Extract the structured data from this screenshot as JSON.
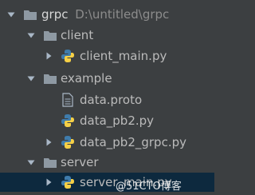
{
  "project_tree": {
    "root": {
      "name": "grpc",
      "path": "D:\\untitled\\grpc"
    },
    "items": [
      {
        "label": "client"
      },
      {
        "label": "client_main.py"
      },
      {
        "label": "example"
      },
      {
        "label": "data.proto"
      },
      {
        "label": "data_pb2.py"
      },
      {
        "label": "data_pb2_grpc.py"
      },
      {
        "label": "server"
      },
      {
        "label": "server_main.py"
      }
    ]
  },
  "watermark": "@51CTO博客",
  "colors": {
    "background": "#3c3f41",
    "selected_row": "#0d293e",
    "text": "#bbbbbb",
    "path_text": "#8c8c8c",
    "folder": "#8e99a3",
    "python_blue": "#3f7cac",
    "python_yellow": "#f6d046"
  },
  "icons": [
    "chevron-down-icon",
    "chevron-right-icon",
    "folder-icon",
    "python-file-icon",
    "text-file-icon"
  ]
}
